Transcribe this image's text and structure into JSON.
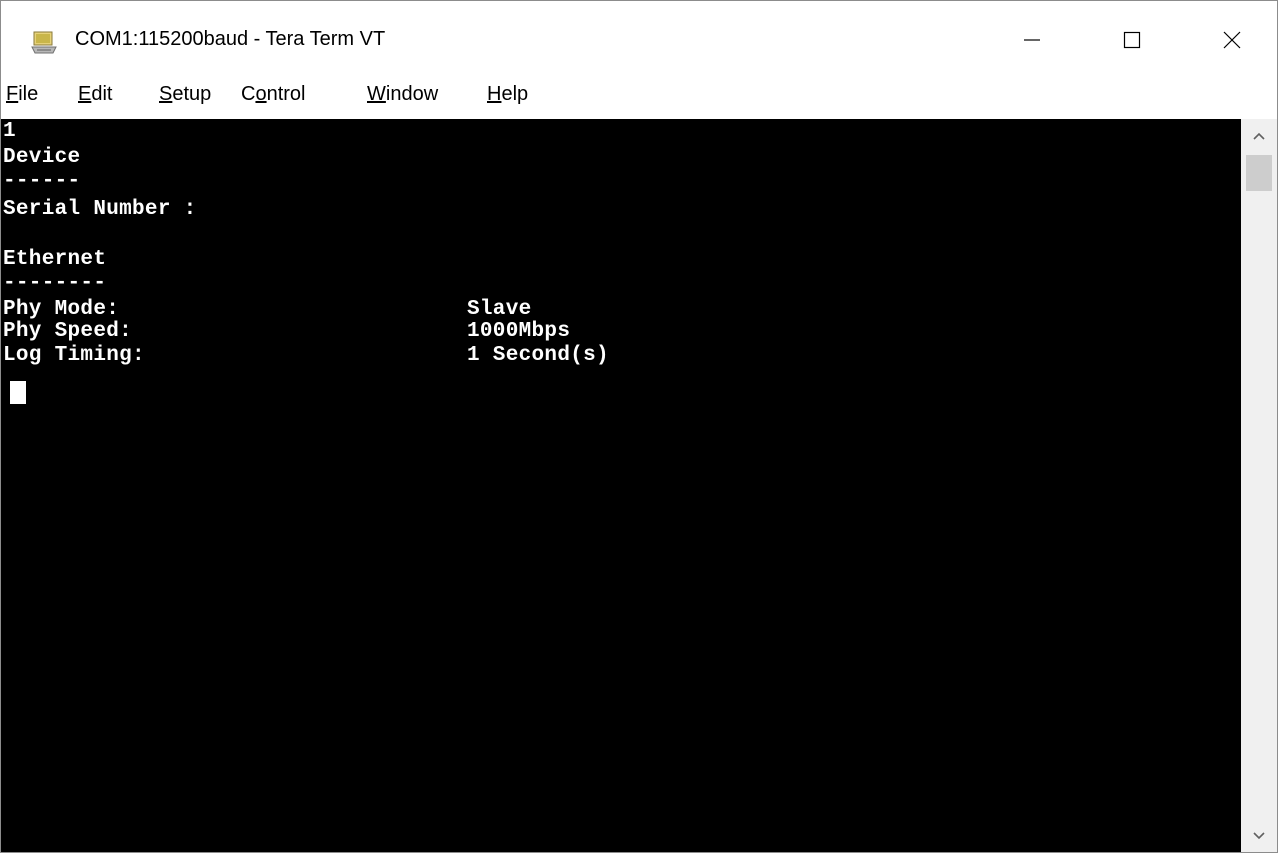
{
  "window": {
    "title": "COM1:115200baud - Tera Term VT"
  },
  "menu": [
    {
      "accel": "F",
      "rest": "ile"
    },
    {
      "accel": "E",
      "rest": "dit"
    },
    {
      "accel": "S",
      "rest": "etup"
    },
    {
      "pre": "C",
      "accel": "o",
      "rest": "ntrol"
    },
    {
      "accel": "W",
      "rest": "indow"
    },
    {
      "accel": "H",
      "rest": "elp"
    }
  ],
  "terminal": {
    "lines": [
      "1",
      "Device",
      "------",
      "Serial Number :",
      "",
      "Ethernet",
      "--------",
      "Phy Mode:",
      "Phy Speed:",
      "Log Timing:"
    ],
    "values": {
      "phy_mode": "Slave",
      "phy_speed": "1000Mbps",
      "log_timing": "1 Second(s)"
    }
  },
  "icons": {
    "app": "tera-term-icon",
    "minimize": "minimize-icon",
    "maximize": "maximize-icon",
    "close": "close-icon",
    "scroll_up": "chevron-up-icon",
    "scroll_down": "chevron-down-icon"
  },
  "colors": {
    "terminal_bg": "#000000",
    "terminal_fg": "#ffffff"
  }
}
